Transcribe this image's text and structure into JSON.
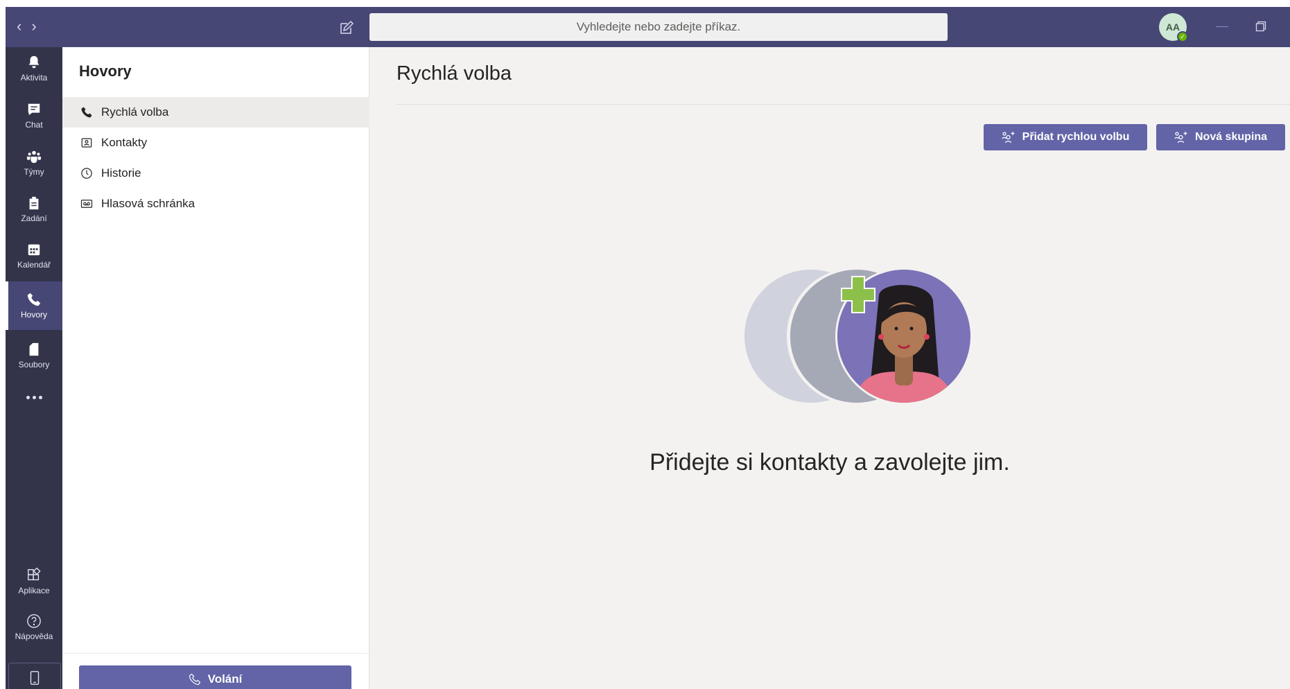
{
  "topbar": {
    "back_arrow": "‹",
    "forward_arrow": "›",
    "search_placeholder": "Vyhledejte nebo zadejte příkaz.",
    "avatar_initials": "AA",
    "status_check": "✓",
    "close_glyph": "✕",
    "icons": [
      "compose-icon",
      "minimize-icon",
      "maximize-icon",
      "close-icon"
    ]
  },
  "rail": {
    "items": [
      {
        "label": "Aktivita",
        "icon": "bell-icon"
      },
      {
        "label": "Chat",
        "icon": "chat-icon"
      },
      {
        "label": "Týmy",
        "icon": "teams-icon"
      },
      {
        "label": "Zadání",
        "icon": "assignments-icon"
      },
      {
        "label": "Kalendář",
        "icon": "calendar-icon"
      },
      {
        "label": "Hovory",
        "icon": "phone-icon",
        "active": true
      },
      {
        "label": "Soubory",
        "icon": "files-icon"
      }
    ],
    "bottom": [
      {
        "label": "Aplikace",
        "icon": "apps-icon"
      },
      {
        "label": "Nápověda",
        "icon": "help-icon"
      }
    ]
  },
  "panel": {
    "title": "Hovory",
    "items": [
      {
        "label": "Rychlá volba",
        "icon": "phone-icon",
        "active": true
      },
      {
        "label": "Kontakty",
        "icon": "contact-card-icon"
      },
      {
        "label": "Historie",
        "icon": "clock-icon"
      },
      {
        "label": "Hlasová schránka",
        "icon": "voicemail-icon"
      }
    ],
    "call_button": "Volání"
  },
  "main": {
    "title": "Rychlá volba",
    "add_speed_dial_button": "Přidat rychlou volbu",
    "new_group_button": "Nová skupina",
    "empty_message": "Přidejte si kontakty a zavolejte jim."
  },
  "colors": {
    "brand": "#464775",
    "accent": "#6264a7",
    "rail": "#33344a",
    "background": "#f3f2f1",
    "presence": "#6bb700"
  }
}
